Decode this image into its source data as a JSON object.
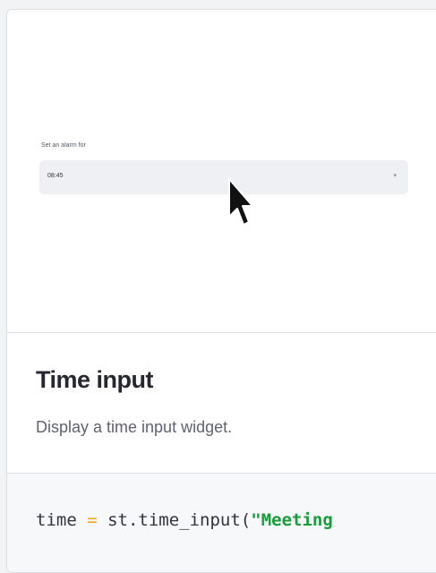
{
  "preview": {
    "label": "Set an alarm for",
    "value": "08:45",
    "chevron": "▾"
  },
  "info": {
    "title": "Time input",
    "description": "Display a time input widget."
  },
  "code": {
    "var": "time",
    "op": " = ",
    "call": "st.time_input(",
    "string": "\"Meeting"
  },
  "icons": {
    "cursor": "mouse-pointer-icon",
    "chevron": "chevron-down-icon"
  },
  "colors": {
    "operator": "#f2a619",
    "string": "#1a9b3c",
    "select_bg": "#eff0f4"
  }
}
